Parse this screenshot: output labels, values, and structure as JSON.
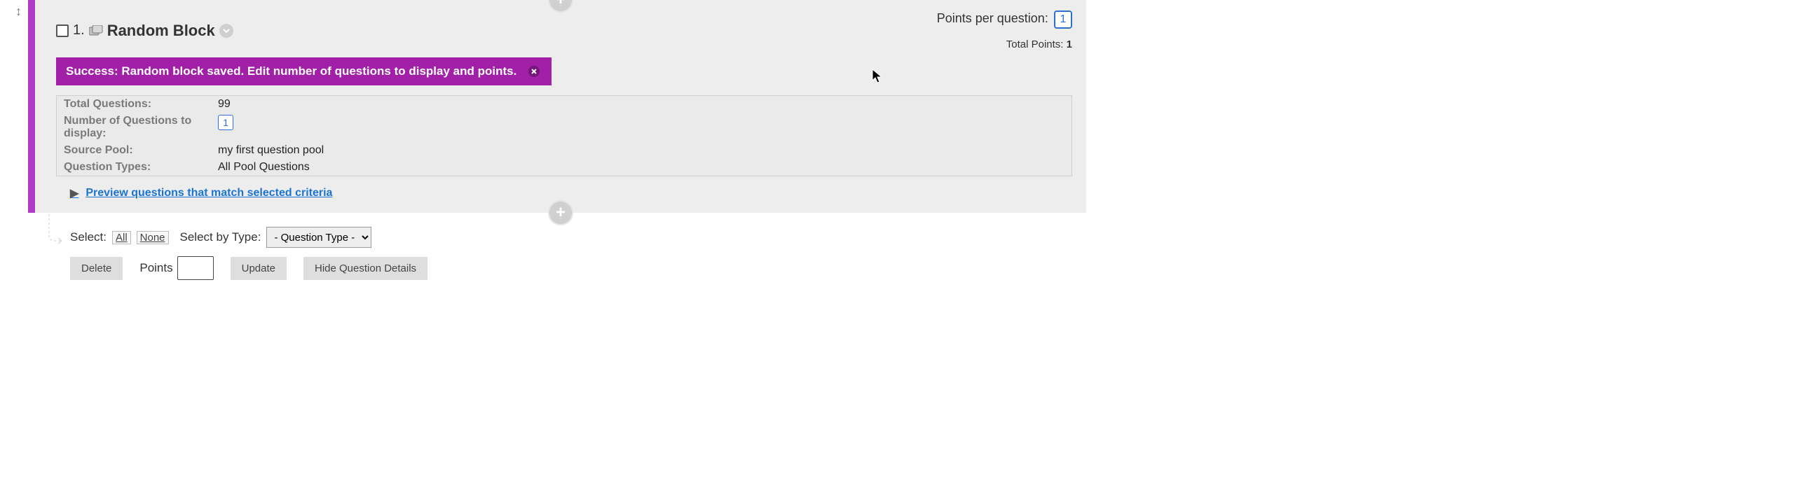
{
  "block": {
    "number": "1.",
    "title": "Random Block",
    "points_per_question_label": "Points per question:",
    "points_per_question_value": "1",
    "total_points_label": "Total Points:",
    "total_points_value": "1"
  },
  "success": {
    "prefix": "Success:",
    "message": "Random block saved. Edit number of questions to display and points."
  },
  "info": {
    "total_q_label": "Total Questions:",
    "total_q_value": "99",
    "num_display_label": "Number of Questions to display:",
    "num_display_value": "1",
    "source_pool_label": "Source Pool:",
    "source_pool_value": "my first question pool",
    "qtypes_label": "Question Types:",
    "qtypes_value": "All Pool Questions"
  },
  "preview_link": "Preview questions that match selected criteria",
  "below": {
    "select_label": "Select:",
    "all": "All",
    "none": "None",
    "select_by_type_label": "Select by Type:",
    "type_placeholder": "- Question Type -",
    "delete": "Delete",
    "points_label": "Points",
    "update": "Update",
    "hide_details": "Hide Question Details"
  }
}
